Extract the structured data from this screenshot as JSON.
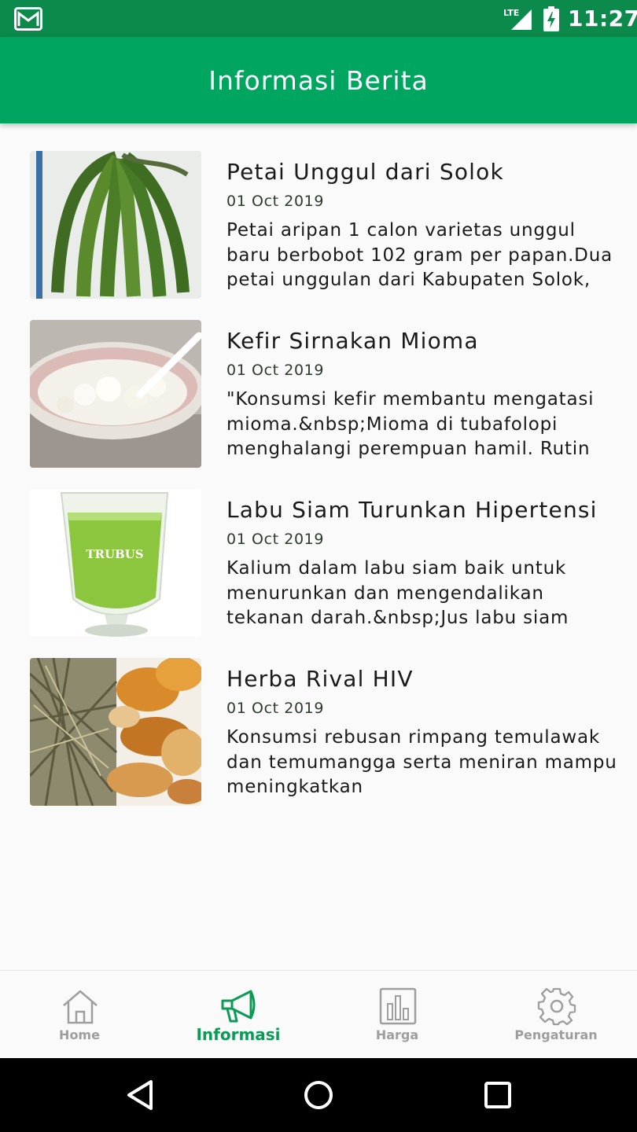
{
  "status_bar": {
    "time": "11:27",
    "network": "LTE"
  },
  "app_bar": {
    "title": "Informasi Berita"
  },
  "news": [
    {
      "title": "Petai Unggul dari Solok",
      "date": "01 Oct 2019",
      "excerpt": "Petai aripan 1 calon varietas unggul baru berbobot 102 gram per papan.Dua petai unggulan dari Kabupaten Solok,",
      "image": "petai-image"
    },
    {
      "title": "Kefir Sirnakan Mioma",
      "date": "01 Oct 2019",
      "excerpt": "\"Konsumsi kefir membantu mengatasi mioma.&nbsp;Mioma di tubafolopi menghalangi perempuan hamil. Rutin",
      "image": "kefir-image"
    },
    {
      "title": "Labu Siam Turunkan Hipertensi",
      "date": "01 Oct 2019",
      "excerpt": "Kalium dalam labu siam baik untuk menurunkan dan mengendalikan tekanan darah.&nbsp;Jus labu siam",
      "image": "juice-image",
      "image_text": "TRUBUS"
    },
    {
      "title": "Herba Rival HIV",
      "date": "01 Oct 2019",
      "excerpt": "Konsumsi rebusan rimpang temulawak dan temumangga serta meniran mampu meningkatkan",
      "image": "herbs-image"
    }
  ],
  "bottom_nav": [
    {
      "label": "Home",
      "icon": "home-icon",
      "active": false
    },
    {
      "label": "Informasi",
      "icon": "megaphone-icon",
      "active": true
    },
    {
      "label": "Harga",
      "icon": "bar-chart-icon",
      "active": false
    },
    {
      "label": "Pengaturan",
      "icon": "gear-icon",
      "active": false
    }
  ],
  "colors": {
    "primary": "#00a660",
    "status_bar": "#0b8a4b",
    "active_nav": "#0a9c55",
    "inactive_nav": "#9e9e9e"
  }
}
